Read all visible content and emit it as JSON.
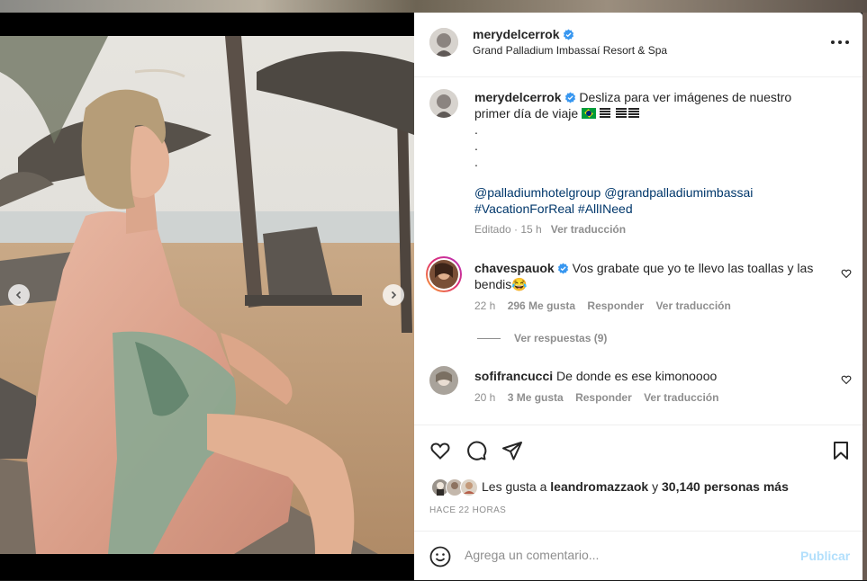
{
  "post": {
    "username": "merydelcerrok",
    "location": "Grand Palladium Imbassaí Resort & Spa"
  },
  "caption": {
    "username": "merydelcerrok",
    "text_line1": "Desliza para ver imágenes de nuestro",
    "text_line2": "primer día de viaje",
    "dot1": ".",
    "dot2": ".",
    "dot3": ".",
    "mention1": "@palladiumhotelgroup",
    "mention2": "@grandpalladiumimbassai",
    "hashtag1": "#VacationForReal",
    "hashtag2": "#AllINeed",
    "edited": "Editado · 15 h",
    "see_translation": "Ver traducción"
  },
  "comments": [
    {
      "username": "chavespauok",
      "text_line1": "Vos grabate que yo te llevo las toallas y las",
      "text_line2": "bendis😂",
      "time": "22 h",
      "likes": "296 Me gusta",
      "reply": "Responder",
      "translate": "Ver traducción",
      "view_replies": "Ver respuestas (9)"
    },
    {
      "username": "sofifrancucci",
      "text": "De donde es ese kimonoooo",
      "time": "20 h",
      "likes": "3 Me gusta",
      "reply": "Responder",
      "translate": "Ver traducción"
    }
  ],
  "likes_summary": {
    "prefix": "Les gusta a",
    "user": "leandromazzaok",
    "joiner": "y",
    "others": "30,140 personas más"
  },
  "timestamp": "HACE 22 HORAS",
  "add_comment": {
    "placeholder": "Agrega un comentario...",
    "publish": "Publicar"
  },
  "colors": {
    "verified": "#3897f0",
    "link": "#00376b",
    "publish_disabled": "#b2dffc"
  },
  "icons": [
    "verified-badge-icon",
    "more-options-icon",
    "like-icon",
    "comment-icon",
    "share-icon",
    "save-icon",
    "emoji-icon",
    "chevron-left-icon",
    "chevron-right-icon",
    "heart-small-icon",
    "brazil-flag-icon"
  ]
}
